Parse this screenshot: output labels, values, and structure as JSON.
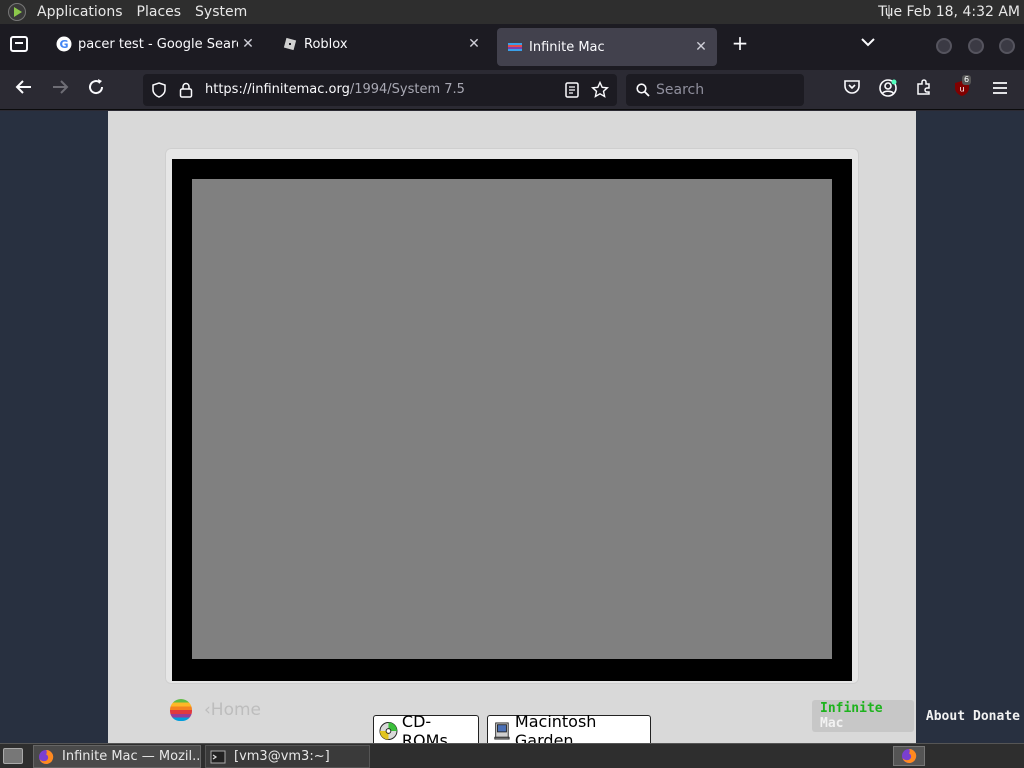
{
  "panel": {
    "menus": [
      "Applications",
      "Places",
      "System"
    ],
    "clock": "Tue Feb 18,  4:32 AM"
  },
  "tabs": [
    {
      "label": "pacer test - Google Search",
      "active": false
    },
    {
      "label": "Roblox",
      "active": false
    },
    {
      "label": "Infinite Mac",
      "active": true
    }
  ],
  "tab_close_glyph": "✕",
  "new_tab_glyph": "+",
  "navbar": {
    "url_host": "https://infinitemac.org",
    "url_path": "/1994/System 7.5",
    "search_placeholder": "Search",
    "extension_badge": "6"
  },
  "page": {
    "home_label": "‹Home",
    "cdroms_label": "CD-ROMs",
    "garden_label": "Macintosh Garden",
    "footer_logo": {
      "part1": "Infinite",
      "part2": " ",
      "part3": "Mac"
    },
    "about_label": "About",
    "donate_label": "Donate"
  },
  "taskbar": {
    "firefox_task": "Infinite Mac — Mozil...",
    "terminal_task": "[vm3@vm3:~]"
  },
  "colors": {
    "panel_bg": "#2e2e2e",
    "tabstrip_bg": "#1c1b22",
    "active_tab_bg": "#42414d",
    "page_bg": "#283040",
    "mac_case": "#d9d9d9",
    "screen_gray": "#808080"
  }
}
